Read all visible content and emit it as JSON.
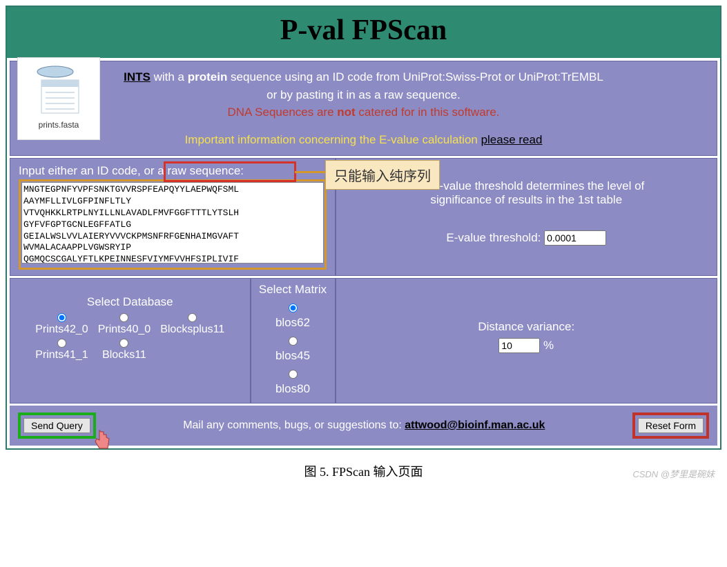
{
  "header": {
    "title": "P-val FPScan"
  },
  "intro": {
    "line1_prefix_link": "INTS",
    "line1_mid1": " with a ",
    "line1_bold": "protein",
    "line1_mid2": " sequence using an ID code from UniProt:Swiss-Prot or UniProt:TrEMBL",
    "line2": "or by pasting it in as a raw sequence.",
    "dna_prefix": "DNA Sequences are ",
    "dna_not": "not",
    "dna_suffix": " catered for in this software.",
    "evalue_info": "Important information concerning the E-value calculation ",
    "please_read": "please read"
  },
  "notepad": {
    "filename": "prints.fasta"
  },
  "input_panel": {
    "prompt": "Input either an ID code, or a raw sequence:",
    "sequence": "MNGTEGPNFYVPFSNKTGVVRSPFEAPQYYLAEPWQFSML\nAAYMFLLIVLGFPINFLTLY\nVTVQHKKLRTPLNYILLNLAVADLFMVFGGFTTTLYTSLH\nGYFVFGPTGCNLEGFFATLG\nGEIALWSLVVLAIERYVVVCKPMSNFRFGENHAIMGVAFT\nWVMALACAAPPLVGWSRYIP\nQGMQCSCGALYFTLKPEINNESFVIYMFVVHFSIPLIVIF",
    "callout": "只能输入纯序列"
  },
  "evalue": {
    "desc1": "The E-value threshold determines the level of",
    "desc2": "significance of results in the 1st table",
    "label": "E-value threshold:",
    "value": "0.0001"
  },
  "database": {
    "title": "Select Database",
    "options": [
      "Prints42_0",
      "Prints40_0",
      "Blocksplus11",
      "Prints41_1",
      "Blocks11"
    ],
    "selected": 0
  },
  "matrix": {
    "title": "Select Matrix",
    "options": [
      "blos62",
      "blos45",
      "blos80"
    ],
    "selected": 0
  },
  "distance": {
    "label": "Distance variance:",
    "value": "10",
    "unit": "%"
  },
  "footer": {
    "send_label": "Send Query",
    "mail_text": "Mail any comments, bugs, or suggestions to: ",
    "mail_link": "attwood@bioinf.man.ac.uk",
    "reset_label": "Reset Form"
  },
  "caption": "图 5. FPScan 输入页面",
  "watermark": "CSDN @梦里是碗妹"
}
